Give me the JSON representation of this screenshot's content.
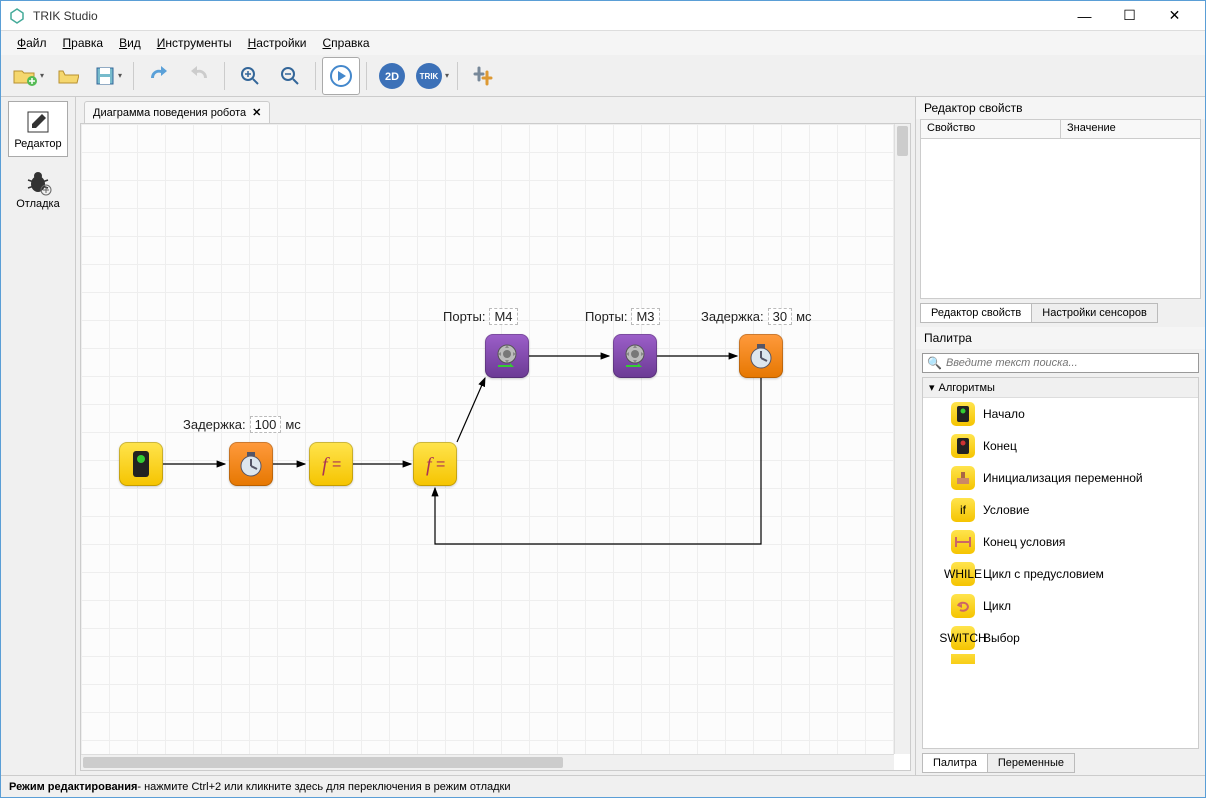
{
  "window": {
    "title": "TRIK Studio"
  },
  "menu": {
    "file": "Файл",
    "edit": "Правка",
    "view": "Вид",
    "tools": "Инструменты",
    "settings": "Настройки",
    "help": "Справка"
  },
  "modes": {
    "editor": "Редактор",
    "debug": "Отладка"
  },
  "tab": {
    "title": "Диаграмма поведения робота"
  },
  "diagram": {
    "nodes": {
      "timer1": {
        "label": "Задержка:",
        "value": "100",
        "unit": "мс"
      },
      "motor_m4": {
        "label": "Порты:",
        "value": "M4"
      },
      "motor_m3": {
        "label": "Порты:",
        "value": "M3"
      },
      "timer2": {
        "label": "Задержка:",
        "value": "30",
        "unit": "мс"
      }
    }
  },
  "props": {
    "panel_title": "Редактор свойств",
    "col_prop": "Свойство",
    "col_val": "Значение",
    "tab_editor": "Редактор свойств",
    "tab_sensors": "Настройки сенсоров"
  },
  "palette": {
    "title": "Палитра",
    "search_placeholder": "Введите текст поиска...",
    "category": "Алгоритмы",
    "items": [
      "Начало",
      "Конец",
      "Инициализация переменной",
      "Условие",
      "Конец условия",
      "Цикл с предусловием",
      "Цикл",
      "Выбор"
    ],
    "tab_palette": "Палитра",
    "tab_vars": "Переменные"
  },
  "status": {
    "mode": "Режим редактирования",
    "hint": " - нажмите Ctrl+2 или кликните здесь для переключения в режим отладки"
  }
}
